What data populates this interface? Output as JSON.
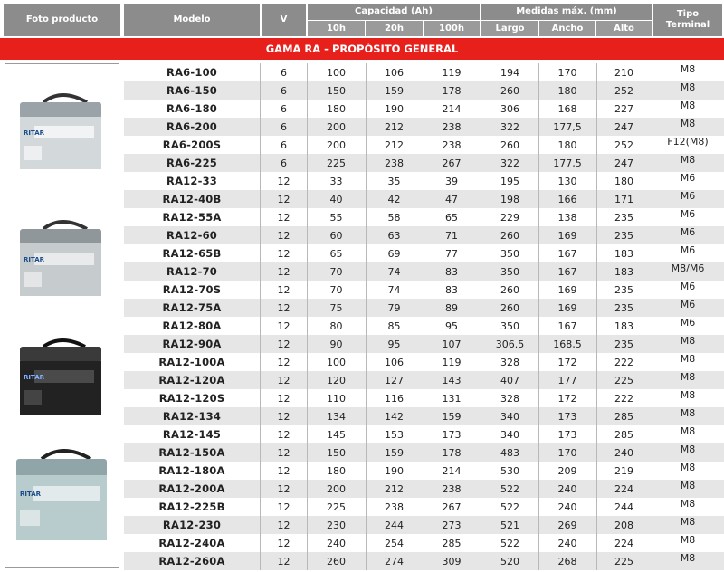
{
  "headers": {
    "foto": "Foto producto",
    "modelo": "Modelo",
    "v": "V",
    "capacidad": "Capacidad (Ah)",
    "cap_10h": "10h",
    "cap_20h": "20h",
    "cap_100h": "100h",
    "medidas": "Medidas máx. (mm)",
    "largo": "Largo",
    "ancho": "Ancho",
    "alto": "Alto",
    "tipo_terminal": "Tipo Terminal"
  },
  "section_title": "GAMA RA - PROPÓSITO GENERAL",
  "photos": [
    {
      "label": "RITAR",
      "color": "#c9ced1",
      "icon": "battery-light-grey-image"
    },
    {
      "label": "RITAR",
      "color": "#bfc4c7",
      "icon": "battery-grey-image"
    },
    {
      "label": "RITAR",
      "color": "#2a2a2a",
      "icon": "battery-black-image"
    },
    {
      "label": "RITAR",
      "color": "#a9bfc2",
      "icon": "battery-blue-grey-image"
    }
  ],
  "rows": [
    {
      "model": "RA6-100",
      "v": "6",
      "c10": "100",
      "c20": "106",
      "c100": "119",
      "largo": "194",
      "ancho": "170",
      "alto": "210",
      "terminal": "M8"
    },
    {
      "model": "RA6-150",
      "v": "6",
      "c10": "150",
      "c20": "159",
      "c100": "178",
      "largo": "260",
      "ancho": "180",
      "alto": "252",
      "terminal": "M8"
    },
    {
      "model": "RA6-180",
      "v": "6",
      "c10": "180",
      "c20": "190",
      "c100": "214",
      "largo": "306",
      "ancho": "168",
      "alto": "227",
      "terminal": "M8"
    },
    {
      "model": "RA6-200",
      "v": "6",
      "c10": "200",
      "c20": "212",
      "c100": "238",
      "largo": "322",
      "ancho": "177,5",
      "alto": "247",
      "terminal": "M8"
    },
    {
      "model": "RA6-200S",
      "v": "6",
      "c10": "200",
      "c20": "212",
      "c100": "238",
      "largo": "260",
      "ancho": "180",
      "alto": "252",
      "terminal": "F12(M8)"
    },
    {
      "model": "RA6-225",
      "v": "6",
      "c10": "225",
      "c20": "238",
      "c100": "267",
      "largo": "322",
      "ancho": "177,5",
      "alto": "247",
      "terminal": "M8"
    },
    {
      "model": "RA12-33",
      "v": "12",
      "c10": "33",
      "c20": "35",
      "c100": "39",
      "largo": "195",
      "ancho": "130",
      "alto": "180",
      "terminal": "M6"
    },
    {
      "model": "RA12-40B",
      "v": "12",
      "c10": "40",
      "c20": "42",
      "c100": "47",
      "largo": "198",
      "ancho": "166",
      "alto": "171",
      "terminal": "M6"
    },
    {
      "model": "RA12-55A",
      "v": "12",
      "c10": "55",
      "c20": "58",
      "c100": "65",
      "largo": "229",
      "ancho": "138",
      "alto": "235",
      "terminal": "M6"
    },
    {
      "model": "RA12-60",
      "v": "12",
      "c10": "60",
      "c20": "63",
      "c100": "71",
      "largo": "260",
      "ancho": "169",
      "alto": "235",
      "terminal": "M6"
    },
    {
      "model": "RA12-65B",
      "v": "12",
      "c10": "65",
      "c20": "69",
      "c100": "77",
      "largo": "350",
      "ancho": "167",
      "alto": "183",
      "terminal": "M6"
    },
    {
      "model": "RA12-70",
      "v": "12",
      "c10": "70",
      "c20": "74",
      "c100": "83",
      "largo": "350",
      "ancho": "167",
      "alto": "183",
      "terminal": "M8/M6"
    },
    {
      "model": "RA12-70S",
      "v": "12",
      "c10": "70",
      "c20": "74",
      "c100": "83",
      "largo": "260",
      "ancho": "169",
      "alto": "235",
      "terminal": "M6"
    },
    {
      "model": "RA12-75A",
      "v": "12",
      "c10": "75",
      "c20": "79",
      "c100": "89",
      "largo": "260",
      "ancho": "169",
      "alto": "235",
      "terminal": "M6"
    },
    {
      "model": "RA12-80A",
      "v": "12",
      "c10": "80",
      "c20": "85",
      "c100": "95",
      "largo": "350",
      "ancho": "167",
      "alto": "183",
      "terminal": "M6"
    },
    {
      "model": "RA12-90A",
      "v": "12",
      "c10": "90",
      "c20": "95",
      "c100": "107",
      "largo": "306.5",
      "ancho": "168,5",
      "alto": "235",
      "terminal": "M8"
    },
    {
      "model": "RA12-100A",
      "v": "12",
      "c10": "100",
      "c20": "106",
      "c100": "119",
      "largo": "328",
      "ancho": "172",
      "alto": "222",
      "terminal": "M8"
    },
    {
      "model": "RA12-120A",
      "v": "12",
      "c10": "120",
      "c20": "127",
      "c100": "143",
      "largo": "407",
      "ancho": "177",
      "alto": "225",
      "terminal": "M8"
    },
    {
      "model": "RA12-120S",
      "v": "12",
      "c10": "110",
      "c20": "116",
      "c100": "131",
      "largo": "328",
      "ancho": "172",
      "alto": "222",
      "terminal": "M8"
    },
    {
      "model": "RA12-134",
      "v": "12",
      "c10": "134",
      "c20": "142",
      "c100": "159",
      "largo": "340",
      "ancho": "173",
      "alto": "285",
      "terminal": "M8"
    },
    {
      "model": "RA12-145",
      "v": "12",
      "c10": "145",
      "c20": "153",
      "c100": "173",
      "largo": "340",
      "ancho": "173",
      "alto": "285",
      "terminal": "M8"
    },
    {
      "model": "RA12-150A",
      "v": "12",
      "c10": "150",
      "c20": "159",
      "c100": "178",
      "largo": "483",
      "ancho": "170",
      "alto": "240",
      "terminal": "M8"
    },
    {
      "model": "RA12-180A",
      "v": "12",
      "c10": "180",
      "c20": "190",
      "c100": "214",
      "largo": "530",
      "ancho": "209",
      "alto": "219",
      "terminal": "M8"
    },
    {
      "model": "RA12-200A",
      "v": "12",
      "c10": "200",
      "c20": "212",
      "c100": "238",
      "largo": "522",
      "ancho": "240",
      "alto": "224",
      "terminal": "M8"
    },
    {
      "model": "RA12-225B",
      "v": "12",
      "c10": "225",
      "c20": "238",
      "c100": "267",
      "largo": "522",
      "ancho": "240",
      "alto": "244",
      "terminal": "M8"
    },
    {
      "model": "RA12-230",
      "v": "12",
      "c10": "230",
      "c20": "244",
      "c100": "273",
      "largo": "521",
      "ancho": "269",
      "alto": "208",
      "terminal": "M8"
    },
    {
      "model": "RA12-240A",
      "v": "12",
      "c10": "240",
      "c20": "254",
      "c100": "285",
      "largo": "522",
      "ancho": "240",
      "alto": "224",
      "terminal": "M8"
    },
    {
      "model": "RA12-260A",
      "v": "12",
      "c10": "260",
      "c20": "274",
      "c100": "309",
      "largo": "520",
      "ancho": "268",
      "alto": "225",
      "terminal": "M8"
    }
  ],
  "colors": {
    "header_bg": "#8c8c8c",
    "band_bg": "#e8201c",
    "row_alt": "#e6e6e6"
  }
}
